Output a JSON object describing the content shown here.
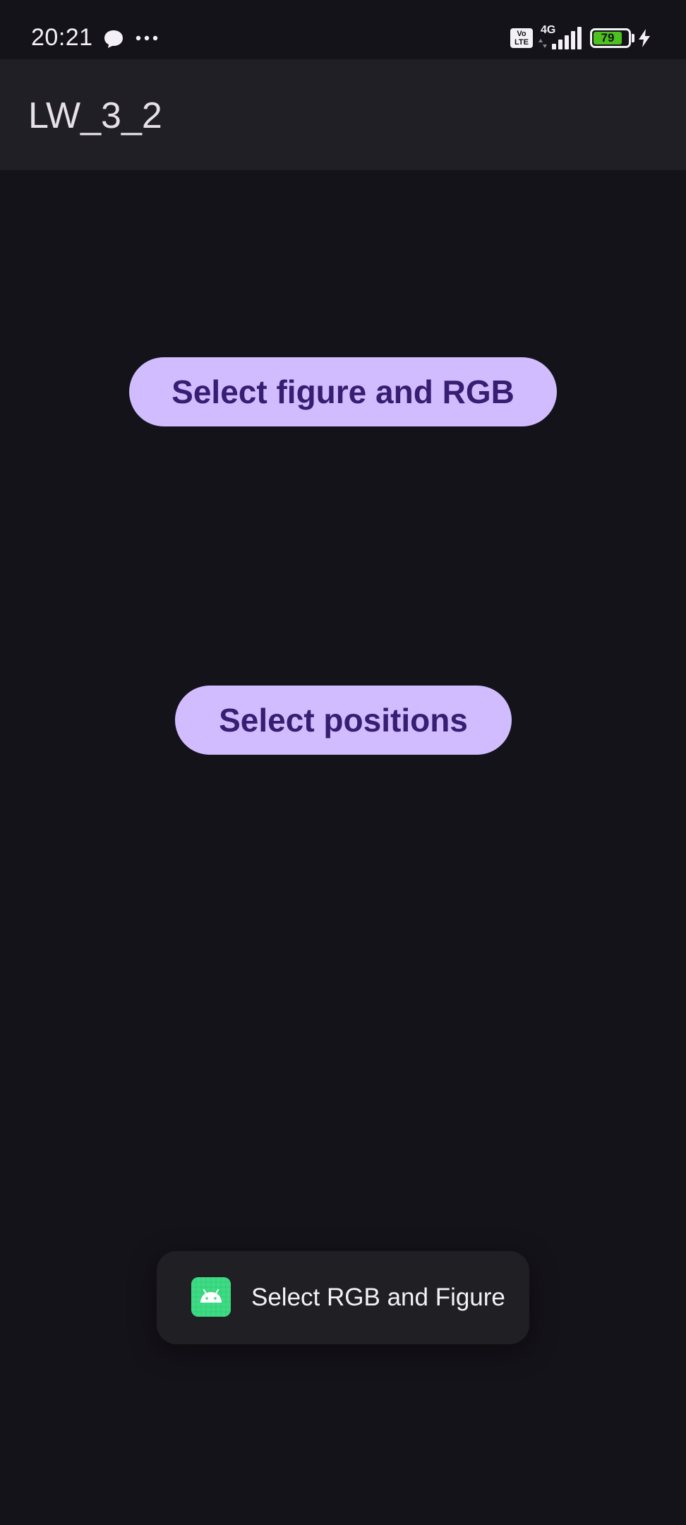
{
  "status_bar": {
    "time": "20:21",
    "volte_label": "Vo\nLTE",
    "network_label": "4G",
    "battery_level": "79",
    "icons": [
      "chat-bubble-icon",
      "more-dots-icon",
      "volte-icon",
      "signal-icon",
      "battery-icon",
      "charging-icon"
    ]
  },
  "app_bar": {
    "title": "LW_3_2"
  },
  "buttons": {
    "select_figure_label": "Select figure and RGB",
    "select_positions_label": "Select positions"
  },
  "toast": {
    "message": "Select RGB and Figure",
    "icon": "android-app-icon"
  },
  "colors": {
    "background": "#15131a",
    "app_bar": "#211f26",
    "button_fill": "#d0bcff",
    "button_text": "#381e72",
    "toast_bg": "#202024",
    "android_green": "#3ddc84",
    "battery_green": "#4cc11f"
  }
}
